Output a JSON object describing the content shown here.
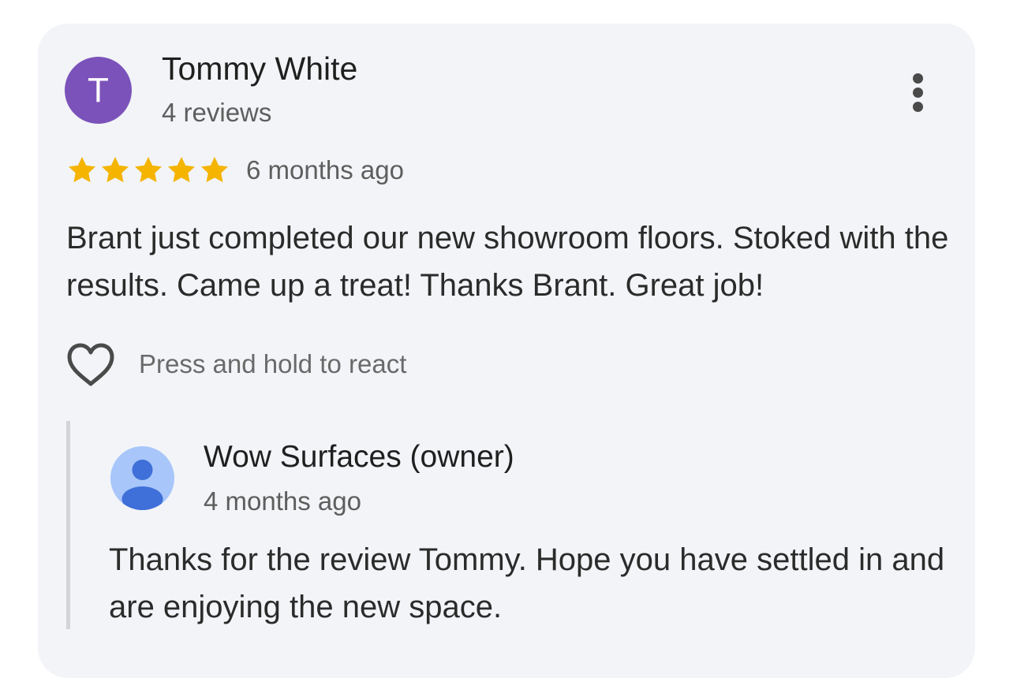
{
  "review": {
    "avatar_letter": "T",
    "avatar_color": "#7b52b9",
    "author": "Tommy White",
    "review_count": "4 reviews",
    "rating": 5,
    "rating_max": 5,
    "star_color": "#f4b400",
    "time": "6 months ago",
    "text": "Brant just completed our new showroom floors. Stoked with the results. Came up a treat! Thanks Brant. Great job!",
    "react_hint": "Press and hold to react",
    "icons": [
      "more-vert-icon",
      "star-icon",
      "heart-outline-icon"
    ]
  },
  "owner_reply": {
    "author": "Wow Surfaces (owner)",
    "time": "4 months ago",
    "text": "Thanks for the review Tommy. Hope you have settled in and are enjoying the new space.",
    "avatar_icon": "person-icon",
    "avatar_color": "#a8c6fa",
    "avatar_glyph_color": "#3f6fd8"
  }
}
